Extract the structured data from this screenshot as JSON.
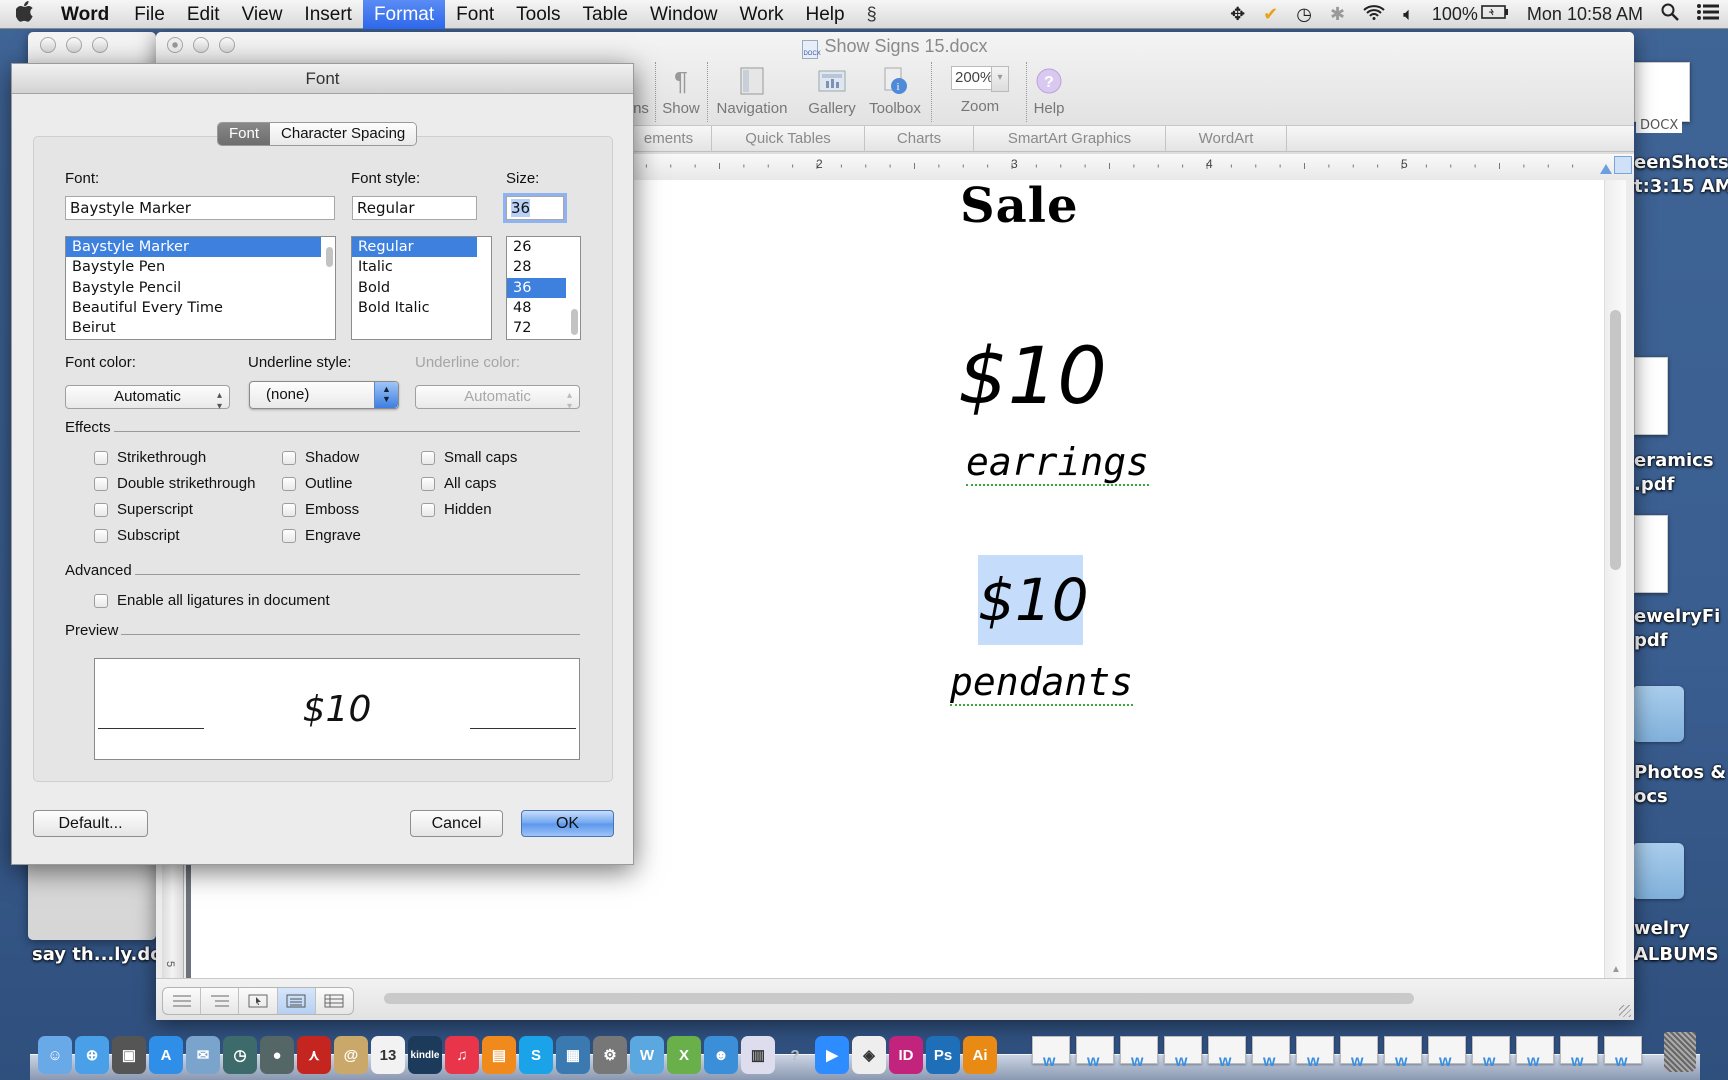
{
  "menubar": {
    "apple_icon": "apple-icon",
    "app_name": "Word",
    "menus": [
      "File",
      "Edit",
      "View",
      "Insert",
      "Format",
      "Font",
      "Tools",
      "Table",
      "Window",
      "Work",
      "Help"
    ],
    "active_menu": "Format",
    "status": {
      "battery": "100%",
      "clock": "Mon 10:58 AM",
      "icons": [
        "script-icon",
        "dropbox-icon",
        "norton-icon",
        "time-machine-icon",
        "bluetooth-icon",
        "wifi-icon",
        "volume-icon",
        "battery-icon",
        "spotlight-icon",
        "notification-icon"
      ]
    }
  },
  "word_window": {
    "title": "Show Signs 15.docx",
    "toolbar": {
      "partial_left": "ns",
      "show": "Show",
      "navigation": "Navigation",
      "gallery": "Gallery",
      "toolbox": "Toolbox",
      "zoom_value": "200%",
      "zoom_label": "Zoom",
      "help": "Help"
    },
    "ribbon_tabs": [
      "ements",
      "Quick Tables",
      "Charts",
      "SmartArt Graphics",
      "WordArt"
    ],
    "ruler_numbers": [
      "2",
      "3",
      "4",
      "5"
    ],
    "vertical_ruler_number": "5",
    "document": {
      "heading": "Sale",
      "items": [
        {
          "price": "$10",
          "label": "earrings"
        },
        {
          "price": "$10",
          "label": "pendants",
          "price_selected": true
        }
      ]
    },
    "view_buttons": [
      "draft-view",
      "outline-view",
      "publishing-layout-view",
      "print-layout-view",
      "notebook-layout-view"
    ],
    "active_view": "print-layout-view"
  },
  "font_dialog": {
    "title": "Font",
    "tabs": [
      "Font",
      "Character Spacing"
    ],
    "active_tab": "Font",
    "font_label": "Font:",
    "font_value": "Baystyle Marker",
    "font_list": [
      "Baystyle Marker",
      "Baystyle Pen",
      "Baystyle Pencil",
      "Beautiful Every Time",
      "Beirut"
    ],
    "font_selected": "Baystyle Marker",
    "style_label": "Font style:",
    "style_value": "Regular",
    "style_list": [
      "Regular",
      "Italic",
      "Bold",
      "Bold Italic"
    ],
    "style_selected": "Regular",
    "size_label": "Size:",
    "size_value": "36",
    "size_list": [
      "26",
      "28",
      "36",
      "48",
      "72"
    ],
    "size_selected": "36",
    "font_color_label": "Font color:",
    "font_color_value": "Automatic",
    "underline_style_label": "Underline style:",
    "underline_style_value": "(none)",
    "underline_color_label": "Underline color:",
    "underline_color_value": "Automatic",
    "effects_label": "Effects",
    "effects": [
      {
        "label": "Strikethrough",
        "checked": false
      },
      {
        "label": "Double strikethrough",
        "checked": false
      },
      {
        "label": "Superscript",
        "checked": false
      },
      {
        "label": "Subscript",
        "checked": false
      },
      {
        "label": "Shadow",
        "checked": false
      },
      {
        "label": "Outline",
        "checked": false
      },
      {
        "label": "Emboss",
        "checked": false
      },
      {
        "label": "Engrave",
        "checked": false
      },
      {
        "label": "Small caps",
        "checked": false
      },
      {
        "label": "All caps",
        "checked": false
      },
      {
        "label": "Hidden",
        "checked": false
      }
    ],
    "advanced_label": "Advanced",
    "ligatures_label": "Enable all ligatures in document",
    "ligatures_checked": false,
    "preview_label": "Preview",
    "preview_text": "$10",
    "buttons": {
      "default": "Default...",
      "cancel": "Cancel",
      "ok": "OK"
    }
  },
  "desktop": {
    "icons": [
      {
        "label_line1": "DOCX",
        "label_line2": ""
      },
      {
        "label_line1": "eenShots",
        "label_line2": "t:3:15 AM"
      },
      {
        "label_line1": "eramics",
        "label_line2": ".pdf"
      },
      {
        "label_line1": "ewelryFi",
        "label_line2": "pdf"
      },
      {
        "label_line1": "Photos &",
        "label_line2": "ocs"
      },
      {
        "label_line1": "welry",
        "label_line2": "ALBUMS"
      }
    ],
    "left_label": "say th...ly.do"
  },
  "dock": {
    "apps": [
      "Finder",
      "Safari",
      "Photo Booth",
      "App Store",
      "Preview",
      "Time Machine",
      "FaceTime",
      "Acrobat",
      "Contacts",
      "Calendar",
      "Kindle",
      "iTunes",
      "iBooks",
      "Skype",
      "iPhoto",
      "System Preferences",
      "Word",
      "Excel",
      "Messenger",
      "Sketchbook",
      "Help",
      "Zoom",
      "Maps",
      "InDesign",
      "Photoshop",
      "Illustrator"
    ],
    "calendar_day": "13",
    "kindle_label": "kindle",
    "id_label": "ID",
    "ps_label": "Ps",
    "ai_label": "Ai"
  }
}
